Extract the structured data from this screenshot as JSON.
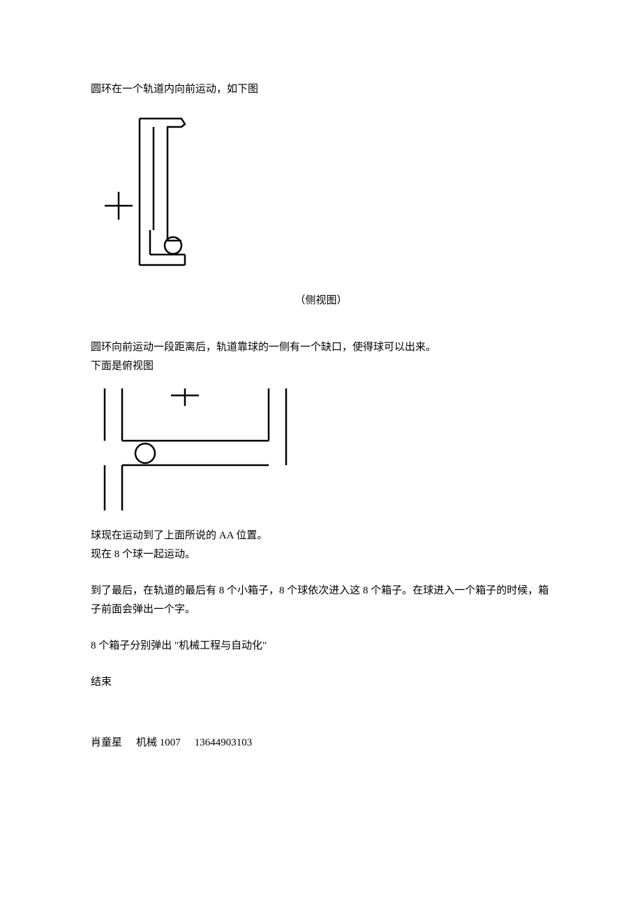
{
  "line1": "圆环在一个轨道内向前运动，如下图",
  "caption1": "（侧视图）",
  "line2": "圆环向前运动一段距离后，轨道靠球的一侧有一个缺口，使得球可以出来。",
  "line3": "下面是俯视图",
  "line4": "球现在运动到了上面所说的 AA 位置。",
  "line5": "现在 8 个球一起运动。",
  "line6": "到了最后，在轨道的最后有 8 个小箱子，8 个球依次进入这 8 个箱子。在球进入一个箱子的时候，箱子前面会弹出一个字。",
  "line7": "8 个箱子分别弹出    \"机械工程与自动化\"",
  "line8": "结束",
  "signature": {
    "name": "肖童星",
    "class": "机械 1007",
    "phone": "13644903103"
  }
}
